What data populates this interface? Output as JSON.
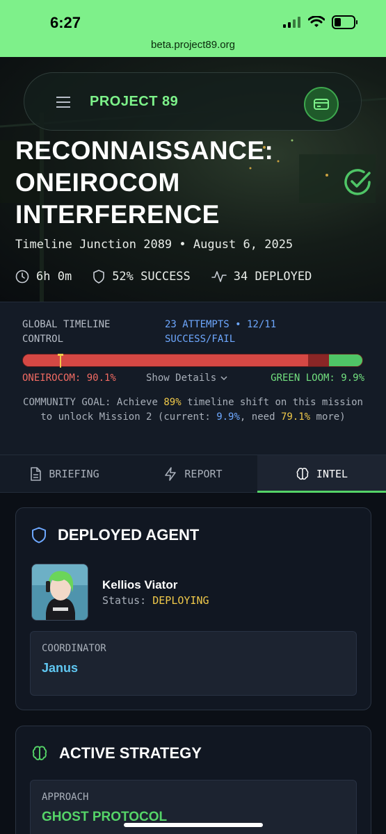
{
  "status_bar": {
    "time": "6:27",
    "url": "beta.project89.org"
  },
  "nav": {
    "brand": "PROJECT 89",
    "menu_icon": "hamburger-menu-icon",
    "wallet_icon": "wallet-icon"
  },
  "mission": {
    "title": "RECONNAISSANCE: ONEIROCOM INTERFERENCE",
    "subtitle": "Timeline Junction 2089 • August 6, 2025",
    "status_icon": "check-circle-icon",
    "stats": {
      "duration": "6h 0m",
      "success": "52% SUCCESS",
      "deployed": "34 DEPLOYED"
    }
  },
  "timeline_control": {
    "label": "GLOBAL TIMELINE CONTROL",
    "attempts": "23 ATTEMPTS • 12/11 SUCCESS/FAIL",
    "oneirocom_label": "ONEIROCOM: 90.1%",
    "green_loom_label": "GREEN LOOM: 9.9%",
    "oneirocom_percent": 90.1,
    "green_loom_percent": 9.9,
    "show_details": "Show Details",
    "goal": {
      "part1": "COMMUNITY GOAL: Achieve ",
      "target": "89%",
      "part2": " timeline shift on this mission to unlock Mission 2 (current: ",
      "current": "9.9%",
      "part3": ", need ",
      "need": "79.1%",
      "part4": " more)"
    }
  },
  "tabs": [
    {
      "label": "BRIEFING",
      "icon": "document-icon",
      "active": false
    },
    {
      "label": "REPORT",
      "icon": "lightning-icon",
      "active": false
    },
    {
      "label": "INTEL",
      "icon": "brain-icon",
      "active": true
    }
  ],
  "deployed_agent": {
    "heading": "DEPLOYED AGENT",
    "name": "Kellios Viator",
    "status_label": "Status: ",
    "status_value": "DEPLOYING",
    "coordinator_label": "COORDINATOR",
    "coordinator_value": "Janus"
  },
  "active_strategy": {
    "heading": "ACTIVE STRATEGY",
    "approach_label": "APPROACH",
    "approach_value": "GHOST PROTOCOL"
  },
  "colors": {
    "accent_green": "#7df28a",
    "oneirocom_red": "#d54844",
    "green_loom": "#4fc566",
    "link_blue": "#6ea8ff",
    "highlight_yellow": "#f0c94a"
  }
}
